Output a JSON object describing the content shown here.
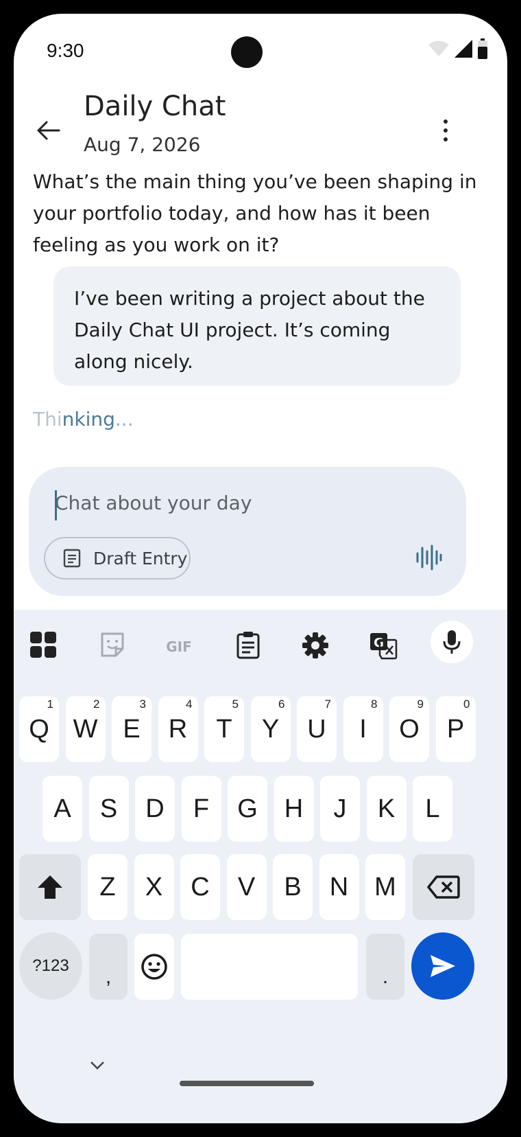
{
  "status": {
    "time": "9:30"
  },
  "header": {
    "title": "Daily Chat",
    "date": "Aug 7, 2026"
  },
  "messages": {
    "ai": "What’s the main thing you’ve been shaping in your portfolio today, and how has it been feeling as you work on it?",
    "user": "I’ve been writing a project about the Daily Chat UI project. It’s coming along nicely.",
    "thinking_a": "Thi",
    "thinking_b": "nking",
    "thinking_c": "..."
  },
  "composer": {
    "placeholder": "Chat about your day",
    "draft_label": "Draft Entry"
  },
  "keyboard": {
    "row1": [
      "Q",
      "W",
      "E",
      "R",
      "T",
      "Y",
      "U",
      "I",
      "O",
      "P"
    ],
    "row1_hints": [
      "1",
      "2",
      "3",
      "4",
      "5",
      "6",
      "7",
      "8",
      "9",
      "0"
    ],
    "row2": [
      "A",
      "S",
      "D",
      "F",
      "G",
      "H",
      "J",
      "K",
      "L"
    ],
    "row3": [
      "Z",
      "X",
      "C",
      "V",
      "B",
      "N",
      "M"
    ],
    "symbols_label": "?123",
    "comma": ",",
    "period": ".",
    "toolbar_gif": "GIF",
    "accent": "#0b57d0"
  },
  "icons": [
    "back-arrow-icon",
    "more-vert-icon",
    "wifi-icon",
    "signal-icon",
    "battery-icon",
    "draft-doc-icon",
    "voice-wave-icon",
    "apps-grid-icon",
    "sticker-icon",
    "gif-icon",
    "clipboard-icon",
    "settings-icon",
    "translate-icon",
    "mic-icon",
    "shift-icon",
    "backspace-icon",
    "emoji-icon",
    "send-icon",
    "chevron-down-icon"
  ]
}
